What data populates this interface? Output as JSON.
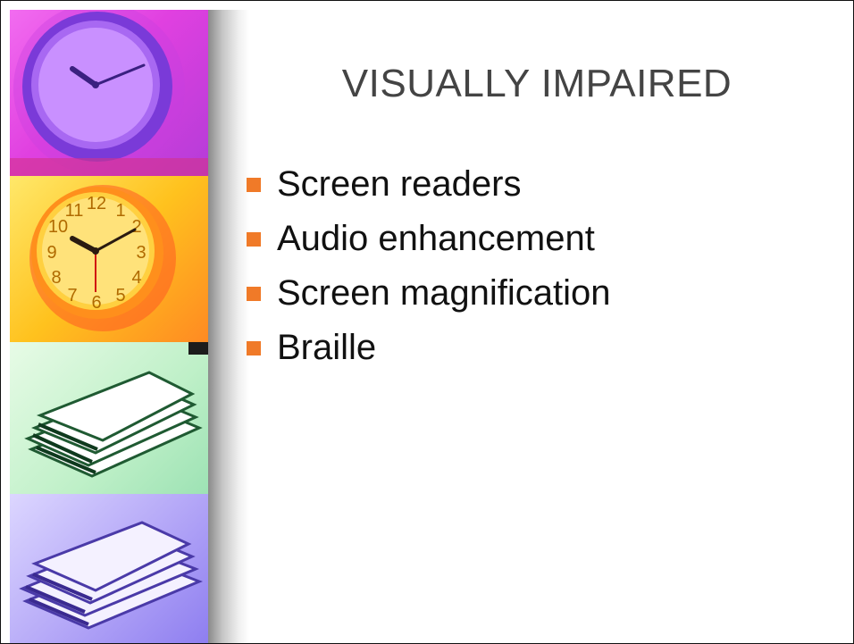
{
  "slide": {
    "title": "VISUALLY IMPAIRED",
    "bullets": [
      {
        "text": "Screen readers"
      },
      {
        "text": "Audio enhancement"
      },
      {
        "text": "Screen magnification"
      },
      {
        "text": "Braille"
      }
    ],
    "bullet_color": "#f07a28"
  },
  "sidebar": {
    "panels": [
      {
        "image": "clock-icon",
        "tint": "#e040e0"
      },
      {
        "image": "clock-icon",
        "tint": "#ffc21e"
      },
      {
        "image": "papers-icon",
        "tint": "#bff0c8"
      },
      {
        "image": "papers-icon",
        "tint": "#b3a6f7"
      }
    ],
    "clock_numbers": [
      "12",
      "1",
      "2",
      "3",
      "4",
      "5",
      "6",
      "7",
      "8",
      "9",
      "10",
      "11"
    ]
  }
}
